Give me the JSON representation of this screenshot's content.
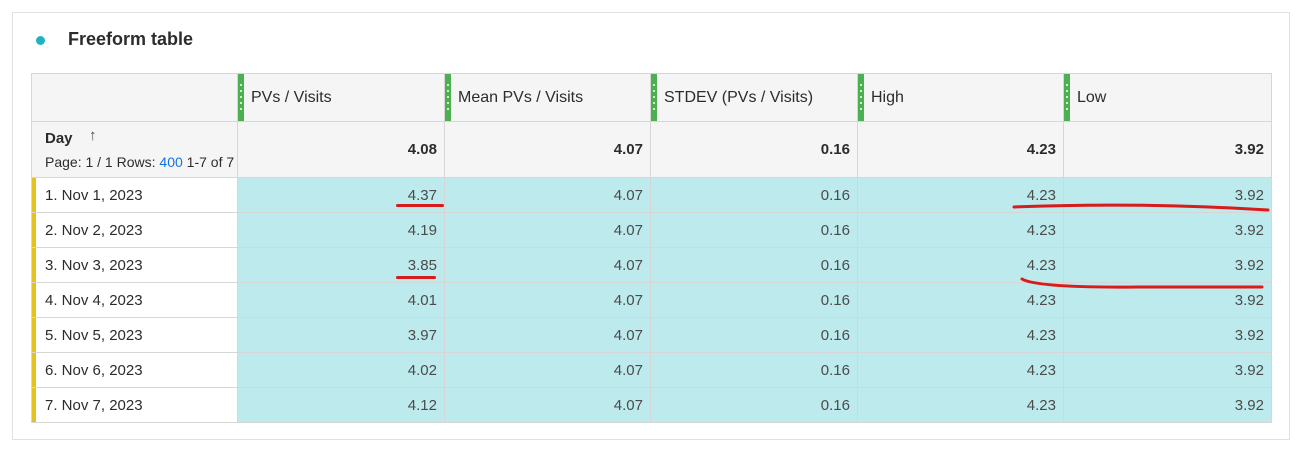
{
  "panel": {
    "title": "Freeform table",
    "accent_color": "#1fb3c2"
  },
  "table": {
    "columns": [
      "PVs / Visits",
      "Mean PVs / Visits",
      "STDEV (PVs / Visits)",
      "High",
      "Low"
    ],
    "dimension": {
      "label": "Day",
      "sort_icon": "arrow-up-icon",
      "pager_prefix": "Page: 1 / 1  Rows:",
      "rows_value": "400",
      "pager_suffix": "1-7 of 7"
    },
    "totals": [
      "4.08",
      "4.07",
      "0.16",
      "4.23",
      "3.92"
    ],
    "rows": [
      {
        "label": "1.  Nov 1, 2023",
        "values": [
          "4.37",
          "4.07",
          "0.16",
          "4.23",
          "3.92"
        ]
      },
      {
        "label": "2.  Nov 2, 2023",
        "values": [
          "4.19",
          "4.07",
          "0.16",
          "4.23",
          "3.92"
        ]
      },
      {
        "label": "3.  Nov 3, 2023",
        "values": [
          "3.85",
          "4.07",
          "0.16",
          "4.23",
          "3.92"
        ]
      },
      {
        "label": "4.  Nov 4, 2023",
        "values": [
          "4.01",
          "4.07",
          "0.16",
          "4.23",
          "3.92"
        ]
      },
      {
        "label": "5.  Nov 5, 2023",
        "values": [
          "3.97",
          "4.07",
          "0.16",
          "4.23",
          "3.92"
        ]
      },
      {
        "label": "6.  Nov 6, 2023",
        "values": [
          "4.02",
          "4.07",
          "0.16",
          "4.23",
          "3.92"
        ]
      },
      {
        "label": "7.  Nov 7, 2023",
        "values": [
          "4.12",
          "4.07",
          "0.16",
          "4.23",
          "3.92"
        ]
      }
    ],
    "colors": {
      "cell_fill": "#bdeaed",
      "column_grip": "#4caf50",
      "row_bar": "#e5c21e",
      "annotation": "#d81b1b"
    }
  }
}
